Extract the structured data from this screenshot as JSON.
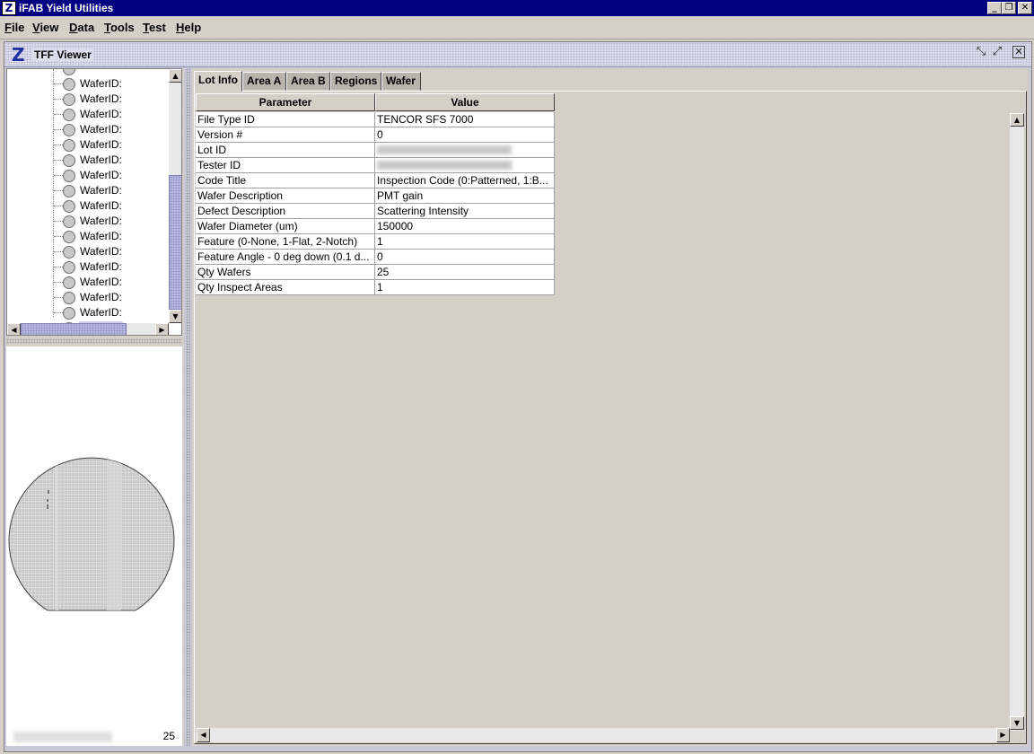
{
  "window": {
    "title": "iFAB Yield Utilities",
    "icon": "app-z-icon",
    "controls": [
      "minimize",
      "restore",
      "close"
    ]
  },
  "menu": [
    "File",
    "View",
    "Data",
    "Tools",
    "Test",
    "Help"
  ],
  "frame": {
    "title": "TFF Viewer",
    "icon": "z-logo-icon",
    "controls": [
      "minimize-icon",
      "maximize-icon",
      "close-icon"
    ]
  },
  "tree": {
    "items": [
      "WaferID:",
      "WaferID:",
      "WaferID:",
      "WaferID:",
      "WaferID:",
      "WaferID:",
      "WaferID:",
      "WaferID:",
      "WaferID:",
      "WaferID:",
      "WaferID:",
      "WaferID:",
      "WaferID:",
      "WaferID:",
      "WaferID:",
      "WaferID:",
      "WaferID:"
    ],
    "selected_index": 16
  },
  "wafer_panel": {
    "count": "25"
  },
  "tabs": [
    "Lot Info",
    "Area A",
    "Area B",
    "Regions",
    "Wafer"
  ],
  "active_tab": "Lot Info",
  "table": {
    "headers": [
      "Parameter",
      "Value"
    ],
    "rows": [
      {
        "param": "File Type ID",
        "value": "TENCOR SFS 7000"
      },
      {
        "param": "Version #",
        "value": "0"
      },
      {
        "param": "Lot ID",
        "value": ""
      },
      {
        "param": "Tester ID",
        "value": ""
      },
      {
        "param": "Code Title",
        "value": "Inspection Code (0:Patterned, 1:B..."
      },
      {
        "param": "Wafer Description",
        "value": "PMT gain"
      },
      {
        "param": "Defect Description",
        "value": "Scattering Intensity"
      },
      {
        "param": "Wafer Diameter (um)",
        "value": "150000"
      },
      {
        "param": "Feature (0-None, 1-Flat, 2-Notch)",
        "value": "1"
      },
      {
        "param": "Feature Angle - 0 deg down (0.1 d...",
        "value": "0"
      },
      {
        "param": "Qty Wafers",
        "value": "25"
      },
      {
        "param": "Qty Inspect Areas",
        "value": "1"
      }
    ]
  }
}
